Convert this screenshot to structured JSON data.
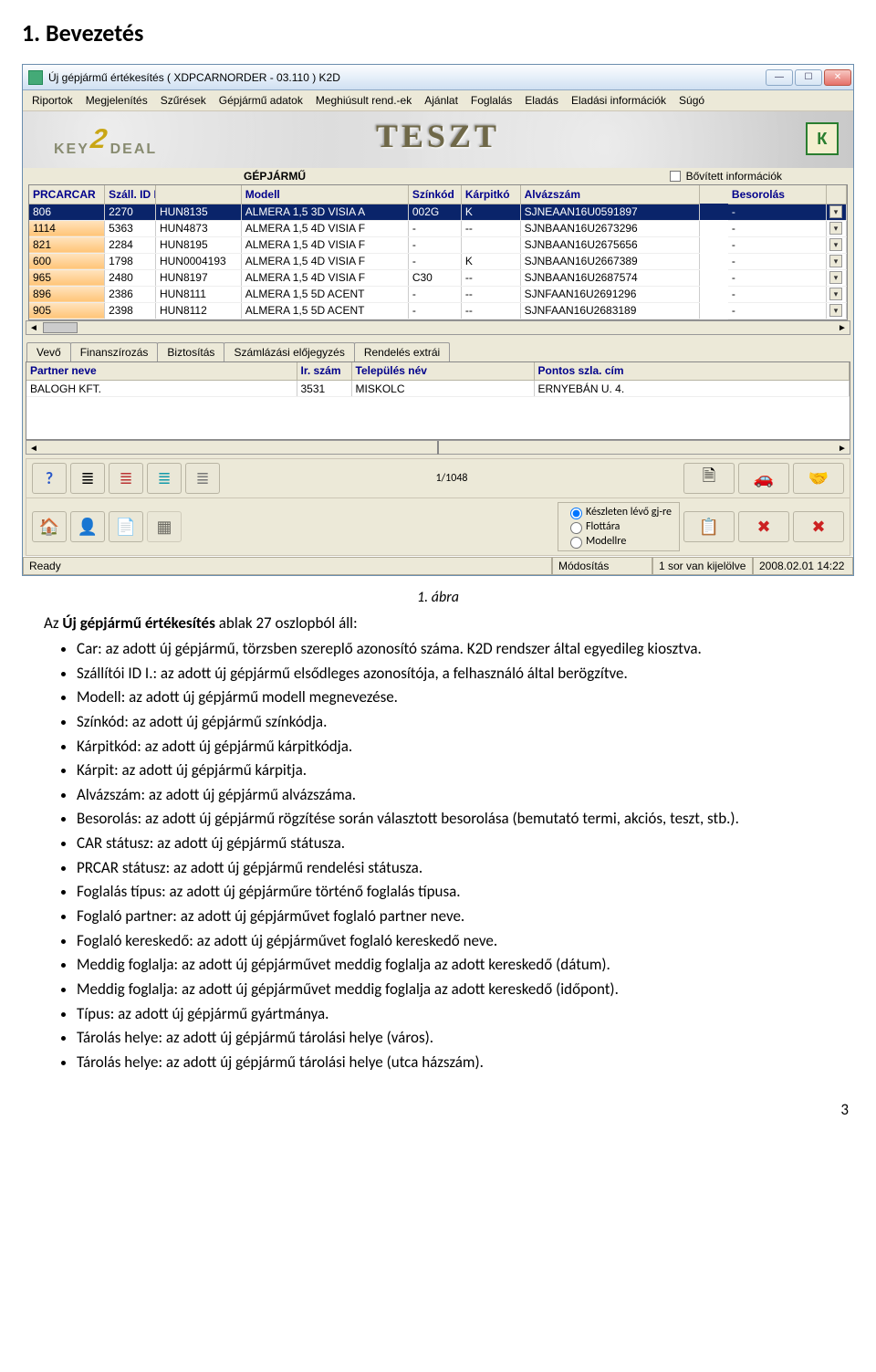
{
  "heading": "1. Bevezetés",
  "window": {
    "title": "Új gépjármű értékesítés ( XDPCARNORDER - 03.110 )    K2D",
    "brand_left": "KEY",
    "brand_right": "DEAL",
    "watermark": "TESZT"
  },
  "menu": [
    "Riportok",
    "Megjelenítés",
    "Szűrések",
    "Gépjármű adatok",
    "Meghiúsult rend.-ek",
    "Ajánlat",
    "Foglalás",
    "Eladás",
    "Eladási információk",
    "Súgó"
  ],
  "section": {
    "title": "GÉPJÁRMŰ",
    "checkbox_label": "Bővített információk"
  },
  "grid": {
    "headers": [
      "PRCARCAR",
      "Száll. ID I.",
      "Modell",
      "Színkód",
      "Kárpitkó",
      "Alvázszám",
      "Besorolás"
    ],
    "rows": [
      {
        "sel": true,
        "c": [
          "806",
          "2270",
          "HUN8135",
          "ALMERA 1,5 3D  VISIA A",
          "002G",
          "K",
          "SJNEAAN16U0591897",
          "-"
        ]
      },
      {
        "sel": false,
        "c": [
          "1114",
          "5363",
          "HUN4873",
          "ALMERA 1,5 4D VISIA F",
          "-",
          "--",
          "SJNBAAN16U2673296",
          "-"
        ]
      },
      {
        "sel": false,
        "c": [
          "821",
          "2284",
          "HUN8195",
          "ALMERA 1,5 4D VISIA F",
          "-",
          "",
          "SJNBAAN16U2675656",
          "-"
        ]
      },
      {
        "sel": false,
        "c": [
          "600",
          "1798",
          "HUN0004193",
          "ALMERA 1,5 4D VISIA F",
          "-",
          "K",
          "SJNBAAN16U2667389",
          "-"
        ]
      },
      {
        "sel": false,
        "c": [
          "965",
          "2480",
          "HUN8197",
          "ALMERA 1,5 4D VISIA F",
          "C30",
          "--",
          "SJNBAAN16U2687574",
          "-"
        ]
      },
      {
        "sel": false,
        "c": [
          "896",
          "2386",
          "HUN8111",
          "ALMERA 1,5 5D ACENT",
          "-",
          "--",
          "SJNFAAN16U2691296",
          "-"
        ]
      },
      {
        "sel": false,
        "c": [
          "905",
          "2398",
          "HUN8112",
          "ALMERA 1,5 5D ACENT",
          "-",
          "--",
          "SJNFAAN16U2683189",
          "-"
        ]
      }
    ]
  },
  "tabs": [
    "Vevő",
    "Finanszírozás",
    "Biztosítás",
    "Számlázási előjegyzés",
    "Rendelés extrái"
  ],
  "subgrid": {
    "headers": [
      "Partner neve",
      "Ir. szám",
      "Település név",
      "Pontos szla. cím"
    ],
    "row": [
      "BALOGH KFT.",
      "3531",
      "MISKOLC",
      "ERNYEBÁN U. 4."
    ]
  },
  "counter": "1/1048",
  "radio": {
    "opts": [
      "Készleten lévő gj-re",
      "Flottára",
      "Modellre"
    ],
    "selected": 0
  },
  "status": {
    "ready": "Ready",
    "mod": "Módosítás",
    "sel": "1 sor van kijelölve",
    "ts": "2008.02.01 14:22"
  },
  "caption": "1. ábra",
  "intro_prefix": "Az ",
  "intro_bold": "Új gépjármű értékesítés",
  "intro_suffix": " ablak 27 oszlopból áll:",
  "bullets": [
    "Car: az adott új gépjármű, törzsben szereplő azonosító száma. K2D rendszer által egyedileg kiosztva.",
    "Szállítói ID I.: az adott új gépjármű elsődleges azonosítója, a felhasználó által berögzítve.",
    "Modell: az adott új gépjármű modell megnevezése.",
    "Színkód: az adott új gépjármű színkódja.",
    "Kárpitkód: az adott új gépjármű kárpitkódja.",
    "Kárpit: az adott új gépjármű kárpitja.",
    "Alvázszám: az adott új gépjármű alvázszáma.",
    "Besorolás: az adott új gépjármű rögzítése során választott besorolása (bemutató termi, akciós, teszt, stb.).",
    "CAR státusz: az adott új gépjármű státusza.",
    "PRCAR státusz: az adott új gépjármű rendelési státusza.",
    "Foglalás típus: az adott új gépjárműre történő foglalás típusa.",
    "Foglaló partner: az adott új gépjárművet foglaló partner neve.",
    "Foglaló kereskedő: az adott új gépjárművet foglaló kereskedő neve.",
    "Meddig foglalja: az adott új gépjárművet meddig foglalja az adott kereskedő (dátum).",
    "Meddig foglalja: az adott új gépjárművet meddig foglalja az adott kereskedő (időpont).",
    "Típus: az adott új gépjármű gyártmánya.",
    "Tárolás helye: az adott új gépjármű tárolási helye (város).",
    "Tárolás helye: az adott új gépjármű tárolási helye (utca házszám)."
  ],
  "page_number": "3"
}
